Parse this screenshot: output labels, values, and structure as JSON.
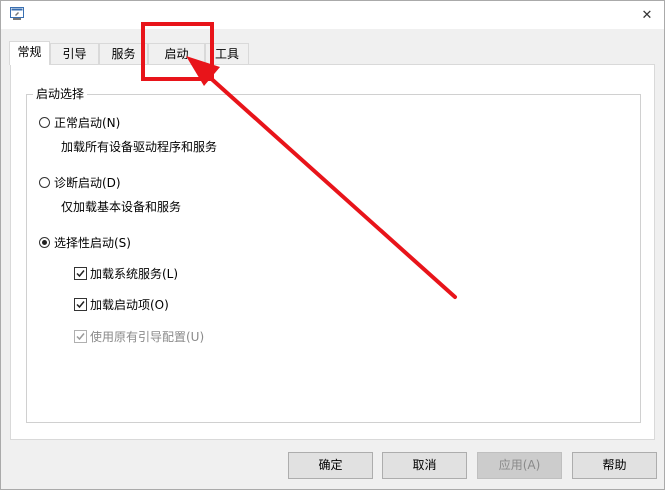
{
  "window": {
    "title": "",
    "close_glyph": "✕"
  },
  "tabs": [
    {
      "label": "常规",
      "active": true
    },
    {
      "label": "引导",
      "active": false
    },
    {
      "label": "服务",
      "active": false
    },
    {
      "label": "启动",
      "active": false
    },
    {
      "label": "工具",
      "active": false
    }
  ],
  "startup_selection": {
    "title": "启动选择",
    "normal": {
      "label": "正常启动(N)",
      "description": "加载所有设备驱动程序和服务",
      "selected": false
    },
    "diagnostic": {
      "label": "诊断启动(D)",
      "description": "仅加载基本设备和服务",
      "selected": false
    },
    "selective": {
      "label": "选择性启动(S)",
      "selected": true,
      "options": [
        {
          "label": "加载系统服务(L)",
          "checked": true,
          "disabled": false
        },
        {
          "label": "加载启动项(O)",
          "checked": true,
          "disabled": false
        },
        {
          "label": "使用原有引导配置(U)",
          "checked": true,
          "disabled": true
        }
      ]
    }
  },
  "buttons": {
    "ok": "确定",
    "cancel": "取消",
    "apply": "应用(A)",
    "help": "帮助"
  },
  "annotation": {
    "color": "#e8141a",
    "highlighted_tab": "启动"
  }
}
